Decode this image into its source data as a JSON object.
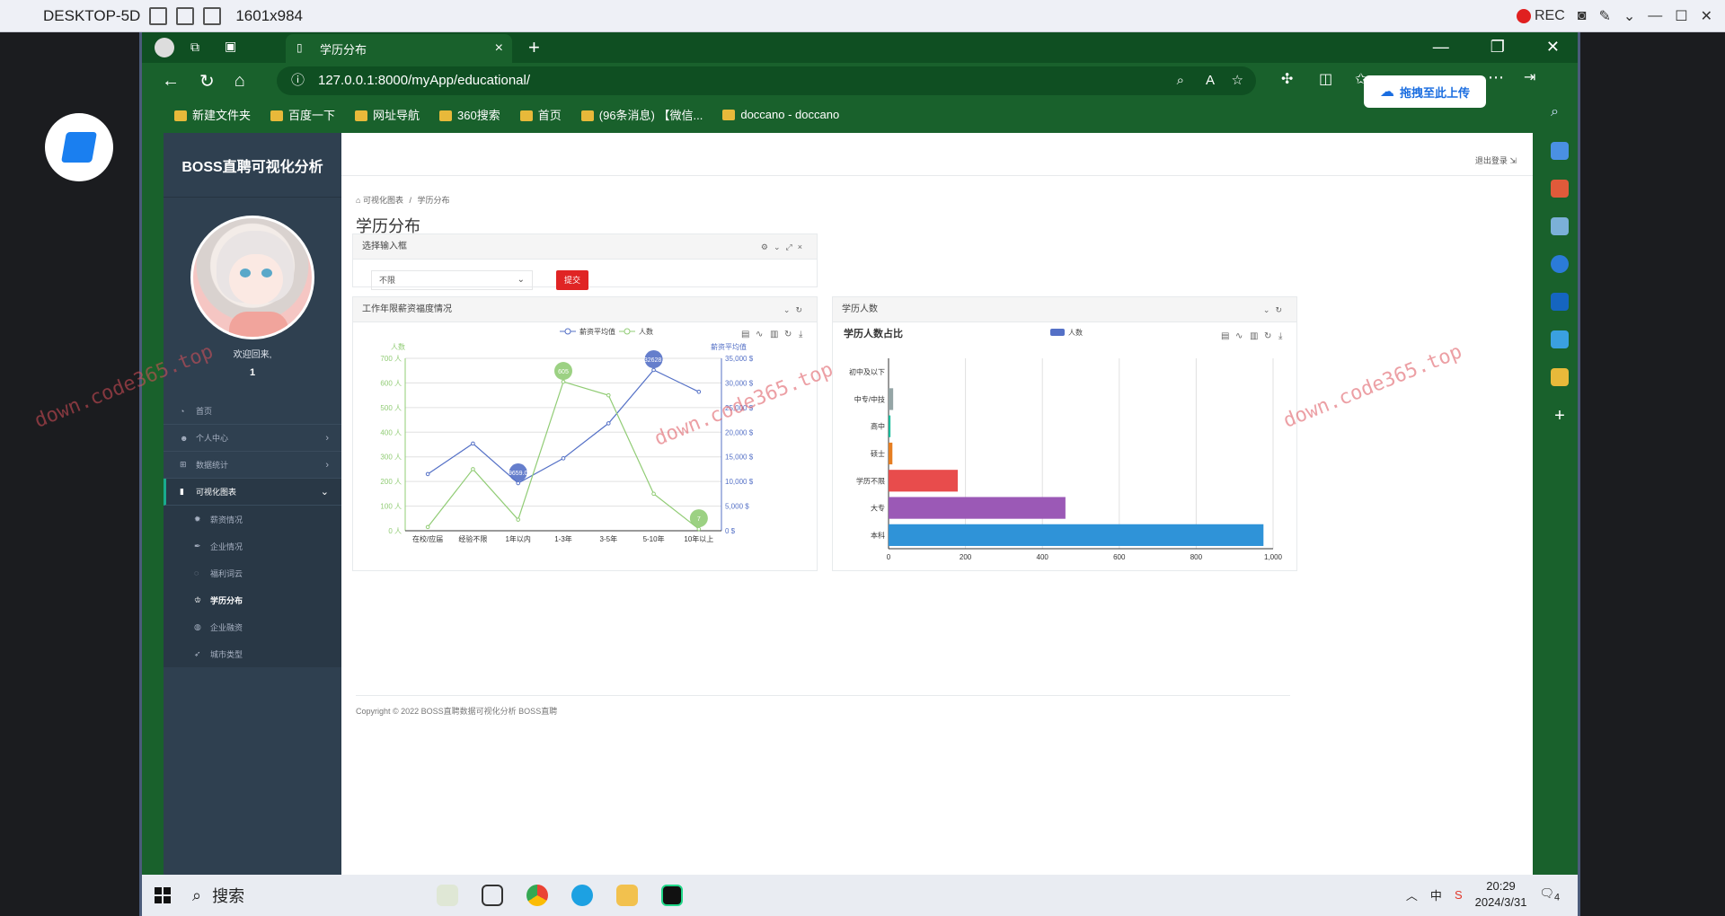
{
  "remote": {
    "title": "DESKTOP-5D",
    "resolution": "1601x984",
    "rec_label": "REC"
  },
  "browser": {
    "tab_title": "学历分布",
    "url": "127.0.0.1:8000/myApp/educational/",
    "upload_button": "拖拽至此上传",
    "bookmarks": [
      "新建文件夹",
      "百度一下",
      "网址导航",
      "360搜索",
      "首页",
      "(96条消息) 【微信...",
      "doccano - doccano"
    ]
  },
  "sidebar": {
    "brand": "BOSS直聘可视化分析",
    "welcome": "欢迎回来,",
    "username": "1",
    "items": [
      {
        "label": "首页",
        "icon": "dashboard-icon"
      },
      {
        "label": "个人中心",
        "icon": "user-icon",
        "arrow": "›"
      },
      {
        "label": "数据统计",
        "icon": "grid-icon",
        "arrow": "›"
      },
      {
        "label": "可视化图表",
        "icon": "bar-chart-icon",
        "arrow": "⌄"
      }
    ],
    "subitems": [
      {
        "label": "薪资情况",
        "icon": "sun-icon"
      },
      {
        "label": "企业情况",
        "icon": "pen-icon"
      },
      {
        "label": "福利词云",
        "icon": "bulb-icon"
      },
      {
        "label": "学历分布",
        "icon": "graduation-icon"
      },
      {
        "label": "企业融资",
        "icon": "globe-icon"
      },
      {
        "label": "城市类型",
        "icon": "rocket-icon"
      }
    ]
  },
  "page": {
    "logout": "退出登录",
    "breadcrumb_home": "可视化图表",
    "breadcrumb_current": "学历分布",
    "title": "学历分布",
    "select_box_title": "选择输入框",
    "select_value": "不限",
    "submit_label": "提交",
    "chart1_title": "工作年限薪资福度情况",
    "chart2_title": "学历人数",
    "footer": "Copyright © 2022 BOSS直聘数据可视化分析 BOSS直聘"
  },
  "watermark": "down.code365.top",
  "taskbar": {
    "search": "搜索",
    "time": "20:29",
    "date": "2024/3/31",
    "notif_count": "4"
  },
  "colors": {
    "browser_green": "#19612c",
    "sidebar": "#2f4050",
    "submit_red": "#e02424",
    "series_salary": "#5470c6",
    "series_people": "#91cc75"
  },
  "chart_data": [
    {
      "type": "line",
      "title": "",
      "categories": [
        "在校/应届",
        "经验不限",
        "1年以内",
        "1-3年",
        "3-5年",
        "5-10年",
        "10年以上"
      ],
      "legend": [
        "薪资平均值",
        "人数"
      ],
      "y_left_label": "人数",
      "y_right_label": "薪资平均值",
      "y_left_ticks": [
        "0 人",
        "100 人",
        "200 人",
        "300 人",
        "400 人",
        "500 人",
        "600 人",
        "700 人"
      ],
      "y_right_ticks": [
        "0 $",
        "5,000 $",
        "10,000 $",
        "15,000 $",
        "20,000 $",
        "25,000 $",
        "30,000 $",
        "35,000 $"
      ],
      "ylim_left": [
        0,
        700
      ],
      "ylim_right": [
        0,
        35000
      ],
      "series": [
        {
          "name": "薪资平均值",
          "axis": "right",
          "values": [
            11500,
            17700,
            9659,
            14700,
            21800,
            32628,
            28200
          ],
          "color": "#5470c6"
        },
        {
          "name": "人数",
          "axis": "left",
          "values": [
            15,
            250,
            45,
            605,
            550,
            150,
            7
          ],
          "color": "#91cc75"
        }
      ],
      "marker_labels": {
        "max_salary": "32628.",
        "min_salary": "9659.0",
        "max_people": "605",
        "min_people": "7"
      }
    },
    {
      "type": "bar",
      "orientation": "horizontal",
      "title": "学历人数占比",
      "legend": [
        "人数"
      ],
      "categories": [
        "本科",
        "大专",
        "学历不限",
        "硕士",
        "高中",
        "中专/中技",
        "初中及以下"
      ],
      "values": [
        975,
        460,
        180,
        10,
        5,
        12,
        0
      ],
      "colors": [
        "#2f93d8",
        "#9b59b6",
        "#e84c4c",
        "#e67e22",
        "#1abc9c",
        "#95a5a6",
        "#bbb"
      ],
      "xlim": [
        0,
        1000
      ],
      "x_ticks": [
        "0",
        "200",
        "400",
        "600",
        "800",
        "1,000"
      ]
    }
  ]
}
